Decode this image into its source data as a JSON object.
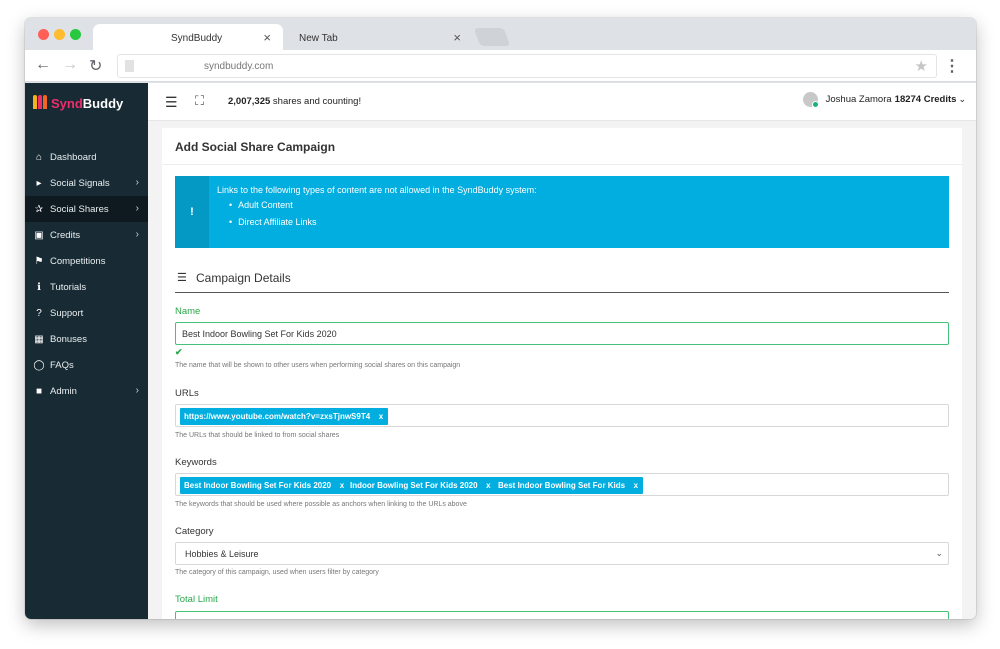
{
  "browser": {
    "tabs": [
      {
        "label": "SyndBuddy"
      },
      {
        "label": "New Tab"
      }
    ],
    "close_glyph": "×",
    "url": "syndbuddy.com"
  },
  "app": {
    "logo": {
      "syn": "Synd",
      "buddy": "Buddy"
    },
    "colors": {
      "sidebar": "#182b35",
      "accent": "#02aee0",
      "success": "#2aa84a"
    },
    "sidebar": [
      {
        "label": "Dashboard",
        "icon": "home-icon",
        "chevron": false
      },
      {
        "label": "Social Signals",
        "icon": "megaphone-icon",
        "chevron": true
      },
      {
        "label": "Social Shares",
        "icon": "share-icon",
        "chevron": true,
        "active": true
      },
      {
        "label": "Credits",
        "icon": "money-icon",
        "chevron": true
      },
      {
        "label": "Competitions",
        "icon": "trophy-icon",
        "chevron": false
      },
      {
        "label": "Tutorials",
        "icon": "info-icon",
        "chevron": false
      },
      {
        "label": "Support",
        "icon": "question-icon",
        "chevron": false
      },
      {
        "label": "Bonuses",
        "icon": "gift-icon",
        "chevron": false
      },
      {
        "label": "FAQs",
        "icon": "chat-icon",
        "chevron": false
      },
      {
        "label": "Admin",
        "icon": "lock-icon",
        "chevron": true
      }
    ],
    "topbar": {
      "count": "2,007,325",
      "count_suffix": "shares and counting!",
      "user_name": "Joshua Zamora",
      "credits": "18274 Credits"
    },
    "card": {
      "title": "Add Social Share Campaign",
      "alert": {
        "icon": "!",
        "text": "Links to the following types of content are not allowed in the SyndBuddy system:",
        "items": [
          "Adult Content",
          "Direct Affiliate Links"
        ]
      },
      "section_title": "Campaign Details",
      "name": {
        "label": "Name",
        "value": "Best Indoor Bowling Set For Kids 2020",
        "help": "The name that will be shown to other users when performing social shares on this campaign"
      },
      "urls": {
        "label": "URLs",
        "tags": [
          "https://www.youtube.com/watch?v=zxsTjnwS9T4"
        ],
        "help": "The URLs that should be linked to from social shares"
      },
      "keywords": {
        "label": "Keywords",
        "tags": [
          "Best Indoor Bowling Set For Kids 2020",
          "Indoor Bowling Set For Kids 2020",
          "Best Indoor Bowling Set For Kids"
        ],
        "help": "The keywords that should be used where possible as anchors when linking to the URLs above"
      },
      "category": {
        "label": "Category",
        "value": "Hobbies & Leisure",
        "help": "The category of this campaign, used when users filter by category"
      },
      "total_limit": {
        "label": "Total Limit"
      },
      "tag_remove": "x"
    }
  }
}
